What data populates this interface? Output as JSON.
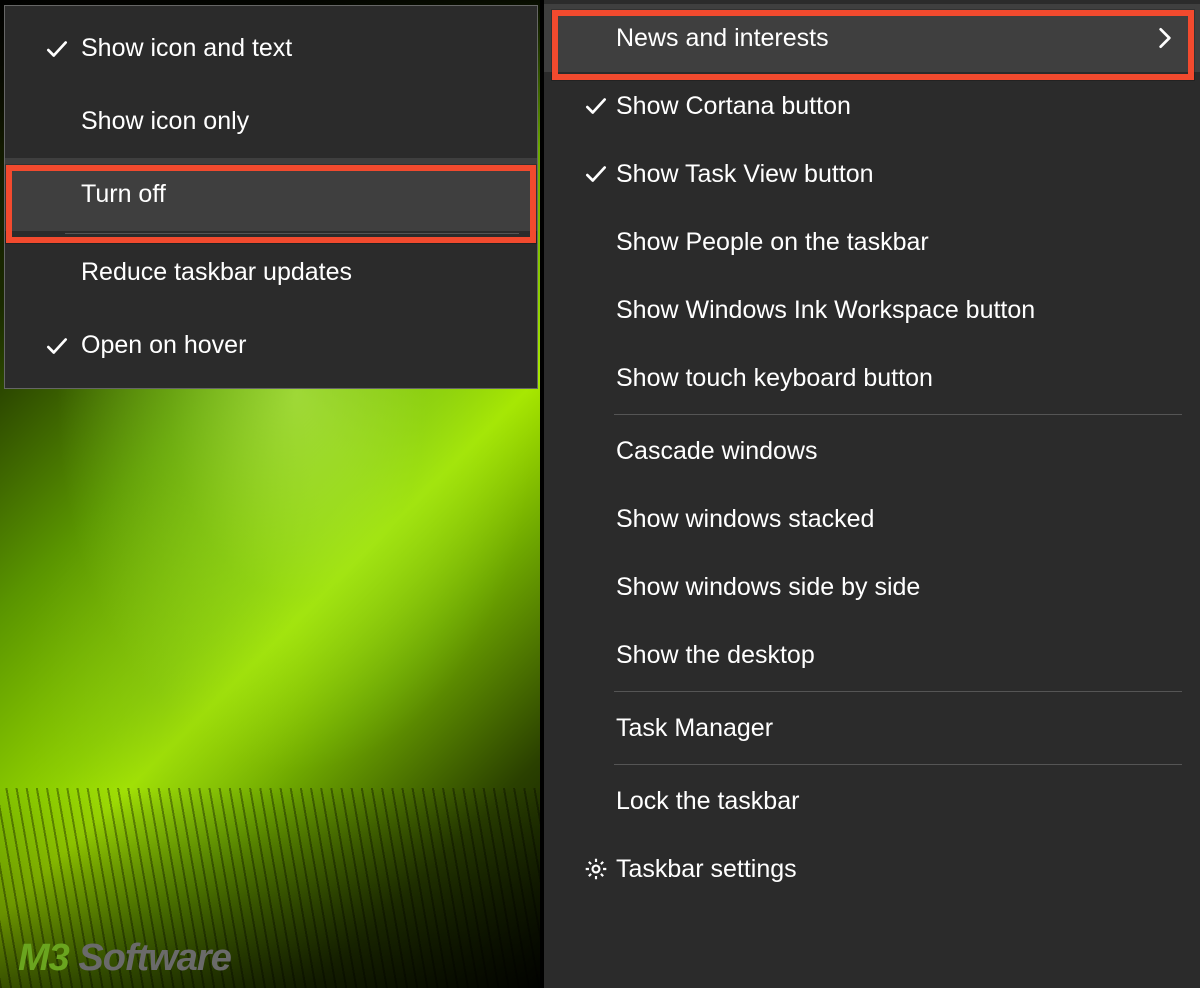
{
  "submenu": {
    "items": [
      {
        "label": "Show icon and text",
        "checked": true,
        "hover": false
      },
      {
        "label": "Show icon only",
        "checked": false,
        "hover": false
      },
      {
        "label": "Turn off",
        "checked": false,
        "hover": true
      },
      {
        "label": "Reduce taskbar updates",
        "checked": false,
        "hover": false
      },
      {
        "label": "Open on hover",
        "checked": true,
        "hover": false
      }
    ]
  },
  "main_menu": {
    "items": [
      {
        "label": "News and interests",
        "checked": false,
        "hover": true,
        "has_submenu": true,
        "icon": null
      },
      {
        "label": "Show Cortana button",
        "checked": true,
        "hover": false,
        "has_submenu": false,
        "icon": null
      },
      {
        "label": "Show Task View button",
        "checked": true,
        "hover": false,
        "has_submenu": false,
        "icon": null
      },
      {
        "label": "Show People on the taskbar",
        "checked": false,
        "hover": false,
        "has_submenu": false,
        "icon": null
      },
      {
        "label": "Show Windows Ink Workspace button",
        "checked": false,
        "hover": false,
        "has_submenu": false,
        "icon": null
      },
      {
        "label": "Show touch keyboard button",
        "checked": false,
        "hover": false,
        "has_submenu": false,
        "icon": null
      },
      {
        "sep": true
      },
      {
        "label": "Cascade windows",
        "checked": false,
        "hover": false,
        "has_submenu": false,
        "icon": null
      },
      {
        "label": "Show windows stacked",
        "checked": false,
        "hover": false,
        "has_submenu": false,
        "icon": null
      },
      {
        "label": "Show windows side by side",
        "checked": false,
        "hover": false,
        "has_submenu": false,
        "icon": null
      },
      {
        "label": "Show the desktop",
        "checked": false,
        "hover": false,
        "has_submenu": false,
        "icon": null
      },
      {
        "sep": true
      },
      {
        "label": "Task Manager",
        "checked": false,
        "hover": false,
        "has_submenu": false,
        "icon": null
      },
      {
        "sep": true
      },
      {
        "label": "Lock the taskbar",
        "checked": false,
        "hover": false,
        "has_submenu": false,
        "icon": null
      },
      {
        "label": "Taskbar settings",
        "checked": false,
        "hover": false,
        "has_submenu": false,
        "icon": "gear"
      }
    ]
  },
  "watermark": {
    "prefix": "M3",
    "suffix": " Software"
  },
  "colors": {
    "menu_bg": "#2b2b2b",
    "hover_bg": "#3f3f3f",
    "highlight": "#f24a2e",
    "text": "#ffffff",
    "watermark_accent": "#6aa51f"
  }
}
